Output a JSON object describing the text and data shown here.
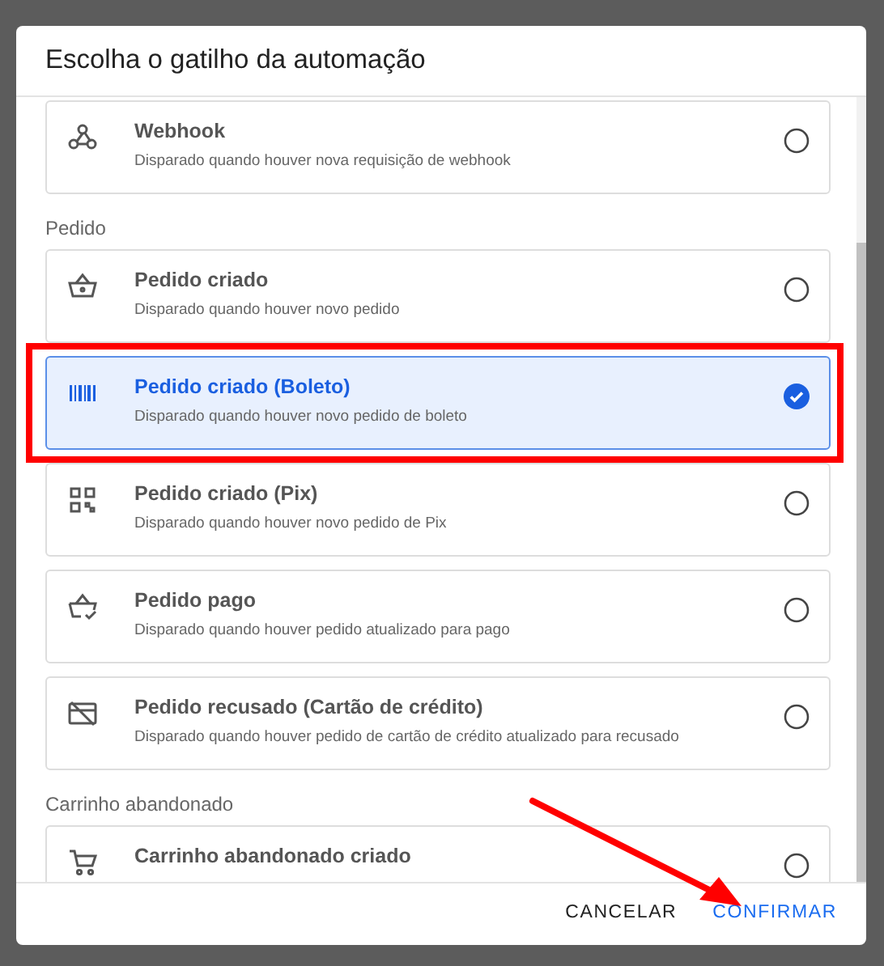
{
  "dialog": {
    "title": "Escolha o gatilho da automação"
  },
  "sections": [
    {
      "items": [
        {
          "title": "Webhook",
          "description": "Disparado quando houver nova requisição de webhook",
          "selected": false,
          "highlighted": false
        }
      ]
    },
    {
      "heading": "Pedido",
      "items": [
        {
          "title": "Pedido criado",
          "description": "Disparado quando houver novo pedido",
          "selected": false,
          "highlighted": false
        },
        {
          "title": "Pedido criado (Boleto)",
          "description": "Disparado quando houver novo pedido de boleto",
          "selected": true,
          "highlighted": true
        },
        {
          "title": "Pedido criado (Pix)",
          "description": "Disparado quando houver novo pedido de Pix",
          "selected": false,
          "highlighted": false
        },
        {
          "title": "Pedido pago",
          "description": "Disparado quando houver pedido atualizado para pago",
          "selected": false,
          "highlighted": false
        },
        {
          "title": "Pedido recusado (Cartão de crédito)",
          "description": "Disparado quando houver pedido de cartão de crédito atualizado para recusado",
          "selected": false,
          "highlighted": false
        }
      ]
    },
    {
      "heading": "Carrinho abandonado",
      "items": [
        {
          "title": "Carrinho abandonado criado",
          "selected": false,
          "highlighted": false
        }
      ]
    }
  ],
  "buttons": [
    {
      "label": "CANCELAR",
      "kind": "secondary"
    },
    {
      "label": "CONFIRMAR",
      "kind": "primary"
    }
  ],
  "annotation_arrow": true
}
